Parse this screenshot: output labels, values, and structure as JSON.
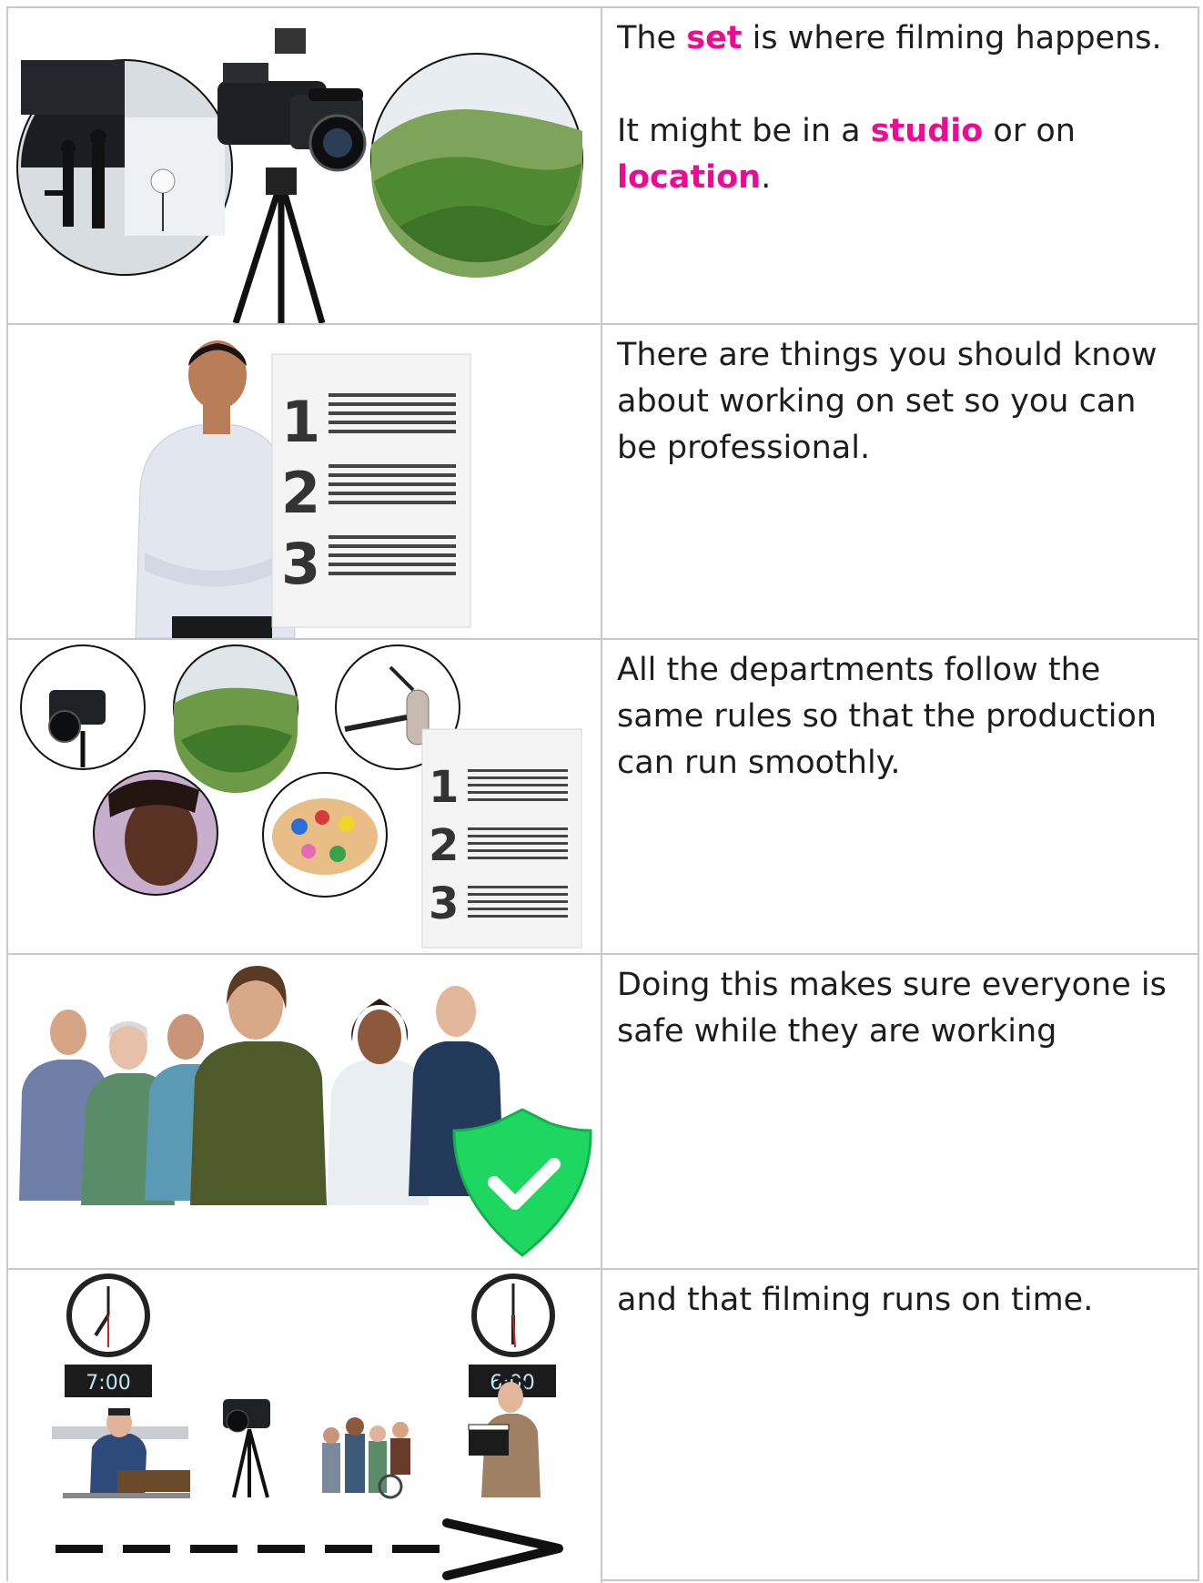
{
  "rows": [
    {
      "t1_pre": "The ",
      "t1_hl": "set",
      "t1_post": " is where filming happens.",
      "t2_pre": "It might be in a ",
      "t2_hl1": "studio",
      "t2_mid": " or on ",
      "t2_hl2": "location",
      "t2_post": "."
    },
    {
      "text": "There are things you should know about working on set so you can be professional."
    },
    {
      "text": "All the departments follow the same rules so that the production can run smoothly."
    },
    {
      "text": "Doing this makes sure everyone is safe while they are working"
    },
    {
      "text": "and that filming runs on time.",
      "clock_start": "7:00",
      "clock_end": "6:00"
    }
  ],
  "list_numbers": [
    "1",
    "2",
    "3"
  ],
  "colors": {
    "highlight": "#ee0a95",
    "border": "#c8c8c8",
    "shield": "#1ed760"
  }
}
